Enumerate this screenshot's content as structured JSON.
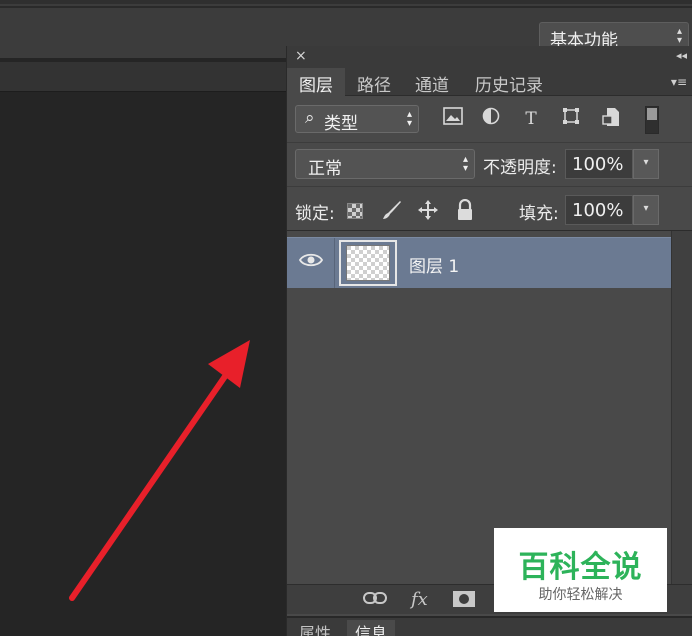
{
  "workspace": {
    "label": "基本功能"
  },
  "panel": {
    "close_icon": "×",
    "collapse_icon": "◂◂",
    "menu_icon": "▾≡",
    "tabs": [
      {
        "label": "图层",
        "active": true
      },
      {
        "label": "路径"
      },
      {
        "label": "通道"
      },
      {
        "label": "历史记录"
      }
    ]
  },
  "filter": {
    "kind_label": "类型",
    "icons": [
      "image-filter-icon",
      "adjustment-filter-icon",
      "type-filter-icon",
      "shape-filter-icon",
      "smart-object-filter-icon"
    ]
  },
  "blend": {
    "mode": "正常",
    "opacity_label": "不透明度:",
    "opacity_value": "100%"
  },
  "lock": {
    "label": "锁定:",
    "fill_label": "填充:",
    "fill_value": "100%"
  },
  "layers": [
    {
      "name": "图层 1",
      "visible": true,
      "selected": true
    }
  ],
  "bottom_icons": [
    "link-icon",
    "fx-icon",
    "mask-icon"
  ],
  "bottom_fx_label": "fx",
  "bottom_tabs": [
    {
      "label": "属性"
    },
    {
      "label": "信息",
      "active": true
    }
  ],
  "watermark": {
    "title": "百科全说",
    "subtitle": "助你轻松解决"
  },
  "colors": {
    "selected_layer": "#6b7a92",
    "panel_bg": "#494949",
    "annotation_arrow": "#e8202a",
    "watermark_green": "#2db35a"
  }
}
